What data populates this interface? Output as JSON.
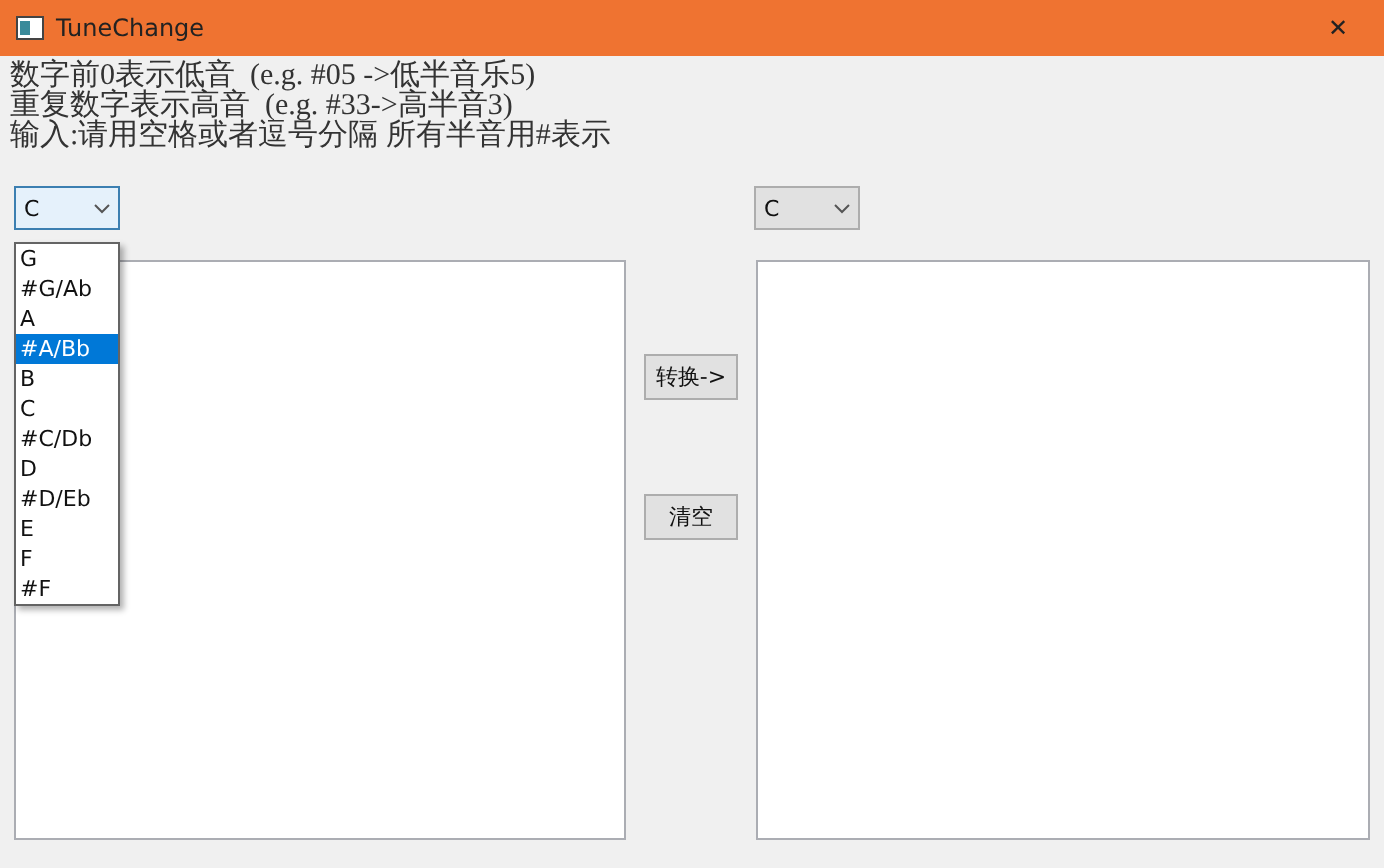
{
  "window": {
    "title": "TuneChange",
    "close": "✕"
  },
  "instructions": [
    "数字前0表示低音  (e.g. #05 ->低半音乐5)",
    "重复数字表示高音  (e.g. #33->高半音3)",
    "输入:请用空格或者逗号分隔 所有半音用#表示"
  ],
  "source_key": {
    "value": "C",
    "expanded": true,
    "options": [
      {
        "label": "G",
        "highlighted": false
      },
      {
        "label": "#G/Ab",
        "highlighted": false
      },
      {
        "label": "A",
        "highlighted": false
      },
      {
        "label": "#A/Bb",
        "highlighted": true
      },
      {
        "label": "B",
        "highlighted": false
      },
      {
        "label": "C",
        "highlighted": false
      },
      {
        "label": "#C/Db",
        "highlighted": false
      },
      {
        "label": "D",
        "highlighted": false
      },
      {
        "label": "#D/Eb",
        "highlighted": false
      },
      {
        "label": "E",
        "highlighted": false
      },
      {
        "label": "F",
        "highlighted": false
      },
      {
        "label": "#F",
        "highlighted": false
      }
    ]
  },
  "target_key": {
    "value": "C"
  },
  "buttons": [
    "转换->",
    "清空"
  ]
}
